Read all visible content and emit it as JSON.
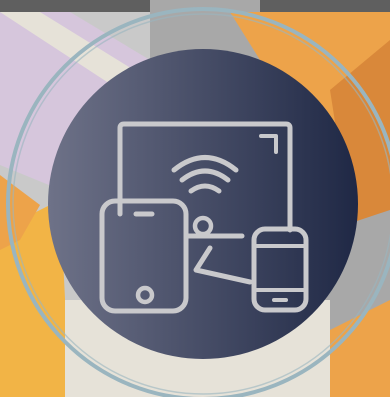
{
  "graphic": {
    "subject": "multi-device-connectivity",
    "palette": {
      "top_bar": "#5f5f5f",
      "lavender": "#d6c6dc",
      "light_gray": "#c9c9c9",
      "mid_gray": "#a8a8a8",
      "orange": "#eda34a",
      "dark_orange": "#d9883a",
      "gold": "#f2b446",
      "cream": "#e6e2d8",
      "ring": "#9ab5bf",
      "circle_left": "#6e7288",
      "circle_right": "#1f2845",
      "icon_stroke": "#c9c9cc"
    },
    "icons": [
      "desktop-monitor-icon",
      "wifi-icon",
      "tablet-icon",
      "smartphone-icon"
    ]
  }
}
